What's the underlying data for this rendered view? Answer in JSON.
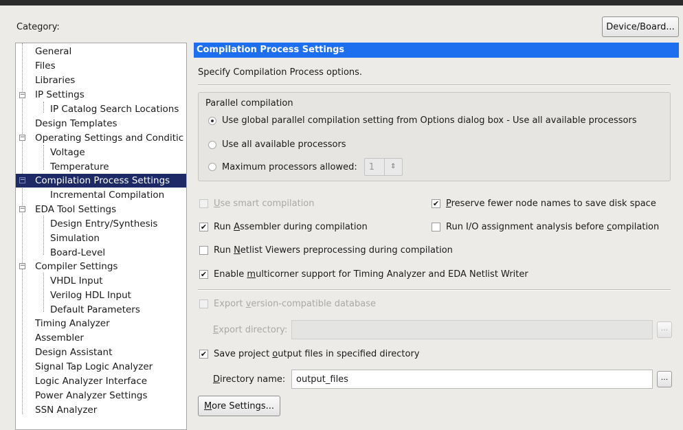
{
  "category_label": "Category:",
  "device_board_button": "Device/Board...",
  "tree": {
    "items": [
      {
        "label": "General"
      },
      {
        "label": "Files"
      },
      {
        "label": "Libraries"
      },
      {
        "label": "IP Settings"
      },
      {
        "label": "IP Catalog Search Locations"
      },
      {
        "label": "Design Templates"
      },
      {
        "label": "Operating Settings and Conditic"
      },
      {
        "label": "Voltage"
      },
      {
        "label": "Temperature"
      },
      {
        "label": "Compilation Process Settings"
      },
      {
        "label": "Incremental Compilation"
      },
      {
        "label": "EDA Tool Settings"
      },
      {
        "label": "Design Entry/Synthesis"
      },
      {
        "label": "Simulation"
      },
      {
        "label": "Board-Level"
      },
      {
        "label": "Compiler Settings"
      },
      {
        "label": "VHDL Input"
      },
      {
        "label": "Verilog HDL Input"
      },
      {
        "label": "Default Parameters"
      },
      {
        "label": "Timing Analyzer"
      },
      {
        "label": "Assembler"
      },
      {
        "label": "Design Assistant"
      },
      {
        "label": "Signal Tap Logic Analyzer"
      },
      {
        "label": "Logic Analyzer Interface"
      },
      {
        "label": "Power Analyzer Settings"
      },
      {
        "label": "SSN Analyzer"
      }
    ],
    "selected": "Compilation Process Settings"
  },
  "panel": {
    "header": "Compilation Process Settings",
    "description": "Specify Compilation Process options.",
    "parallel": {
      "title": "Parallel compilation",
      "opt_global": "Use global parallel compilation setting from Options dialog box - Use all available processors",
      "opt_all": "Use all available processors",
      "opt_max": "Maximum processors allowed:",
      "max_value": "1",
      "selected": "global"
    },
    "options": {
      "smart_compilation": {
        "label_pre": "",
        "label_u": "U",
        "label_post": "se smart compilation",
        "checked": false,
        "enabled": false
      },
      "preserve_fewer": {
        "label_pre": "",
        "label_u": "P",
        "label_post": "reserve fewer node names to save disk space",
        "checked": true
      },
      "run_assembler": {
        "label_pre": "Run ",
        "label_u": "A",
        "label_post": "ssembler during compilation",
        "checked": true
      },
      "run_io": {
        "label_pre": "Run I/O assignment analysis before ",
        "label_u": "c",
        "label_post": "ompilation",
        "checked": false
      },
      "run_netlist": {
        "label_pre": "Run ",
        "label_u": "N",
        "label_post": "etlist Viewers preprocessing during compilation",
        "checked": false
      },
      "enable_multicorner": {
        "label_pre": "Enable ",
        "label_u": "m",
        "label_post": "ulticorner support for Timing Analyzer and EDA Netlist Writer",
        "checked": true
      },
      "export_db": {
        "label_pre": "Export ",
        "label_u": "v",
        "label_post": "ersion-compatible database",
        "checked": false,
        "enabled": false
      },
      "save_output": {
        "label_pre": "Save project ",
        "label_u": "o",
        "label_post": "utput files in specified directory",
        "checked": true
      }
    },
    "export_directory": {
      "label_pre": "",
      "label_u": "E",
      "label_post": "xport directory:",
      "value": ""
    },
    "directory_name": {
      "label_pre": "",
      "label_u": "D",
      "label_post": "irectory name:",
      "value": "output_files"
    },
    "browse_label": "...",
    "more_settings": {
      "label_u": "M",
      "label_post": "ore Settings..."
    }
  },
  "icons": {
    "check": "✔",
    "spin_arrows": "⇕",
    "expander": "−"
  }
}
